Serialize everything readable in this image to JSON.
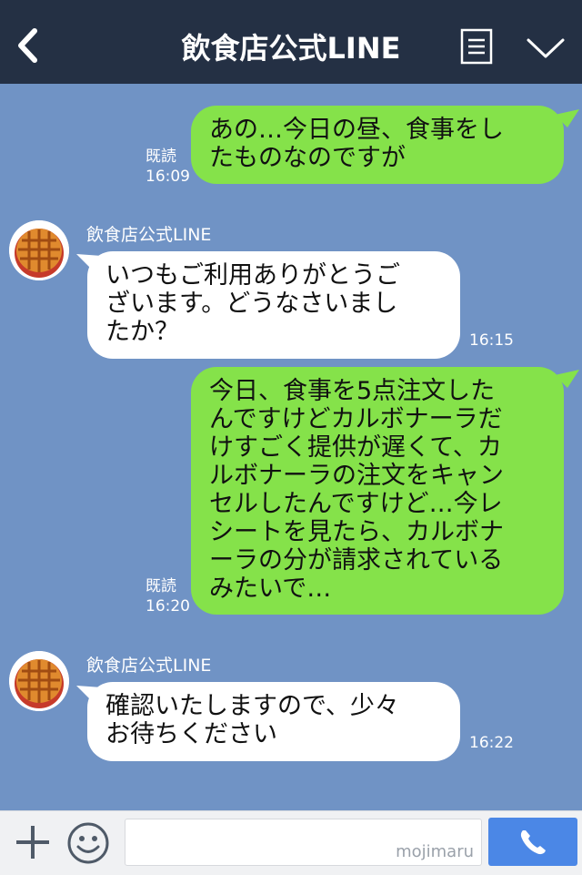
{
  "header": {
    "title": "飲食店公式LINE",
    "back_icon": "back-chevron-icon",
    "menu_icon": "list-icon",
    "expand_icon": "chevron-down-icon",
    "bg_color": "#243044"
  },
  "chat": {
    "bg_color": "#7093c5",
    "messages": [
      {
        "dir": "out",
        "text": "あの…今日の昼、食事をし\nたものなのですが",
        "read": "既読",
        "time": "16:09"
      },
      {
        "dir": "in",
        "sender": "飲食店公式LINE",
        "text": "いつもご利用ありがとうご\nざいます。どうなさいまし\nたか？",
        "time": "16:15"
      },
      {
        "dir": "out",
        "text": "今日、食事を5点注文した\nんですけどカルボナーラだ\nけすごく提供が遅くて、カ\nルボナーラの注文をキャン\nセルしたんですけど…今レ\nシートを見たら、カルボナ\nーラの分が請求されている\nみたいで…",
        "read": "既読",
        "time": "16:20"
      },
      {
        "dir": "in",
        "sender": "飲食店公式LINE",
        "text": "確認いたしますので、少々\nお待ちください",
        "time": "16:22"
      }
    ],
    "colors": {
      "outgoing": "#85e24a",
      "incoming": "#ffffff"
    }
  },
  "footer": {
    "plus_icon": "plus-icon",
    "emoji_icon": "smiley-icon",
    "watermark": "mojimaru",
    "send_icon": "phone-icon",
    "send_color": "#4b87e6"
  }
}
